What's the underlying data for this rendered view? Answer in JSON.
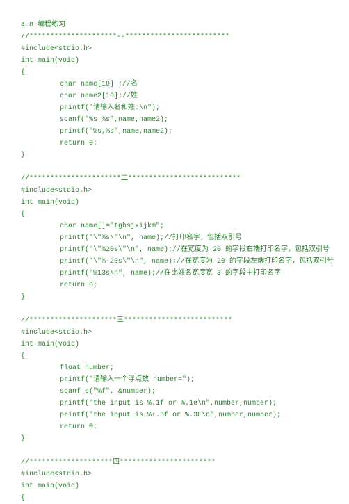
{
  "lines": [
    {
      "text": "4.8 编程练习",
      "indent": 0
    },
    {
      "text": "//*********************--*************************",
      "indent": 0
    },
    {
      "text": "#include<stdio.h>",
      "indent": 0
    },
    {
      "text": "int main(void)",
      "indent": 0
    },
    {
      "text": "{",
      "indent": 0
    },
    {
      "text": "char name[10] ;//名",
      "indent": 2
    },
    {
      "text": "char name2[10];//姓",
      "indent": 2
    },
    {
      "text": "printf(\"请输入名和姓:\\n\");",
      "indent": 2
    },
    {
      "text": "scanf(\"%s %s\",name,name2);",
      "indent": 2
    },
    {
      "text": "printf(\"%s,%s\",name,name2);",
      "indent": 2
    },
    {
      "text": "return 0;",
      "indent": 2
    },
    {
      "text": "}",
      "indent": 0
    },
    {
      "type": "blank"
    },
    {
      "text": "//**********************二***************************",
      "indent": 0
    },
    {
      "text": "#include<stdio.h>",
      "indent": 0
    },
    {
      "text": "int main(void)",
      "indent": 0
    },
    {
      "text": "{",
      "indent": 0
    },
    {
      "text": "char name[]=\"tghsjxijkm\";",
      "indent": 2
    },
    {
      "text": "printf(\"\\\"%s\\\"\\n\", name);//打印名字，包括双引号",
      "indent": 2
    },
    {
      "text": "printf(\"\\\"%20s\\\"\\n\", name);//在宽度为 20 的字段右端打印名字，包括双引号",
      "indent": 2
    },
    {
      "text": "printf(\"\\\"%-20s\\\"\\n\", name);//在宽度为 20 的字段左端打印名字，包括双引号",
      "indent": 2
    },
    {
      "text": "printf(\"%13s\\n\", name);//在比姓名宽度宽 3 的字段中打印名字",
      "indent": 2
    },
    {
      "text": "return 0;",
      "indent": 2
    },
    {
      "text": "}",
      "indent": 0
    },
    {
      "type": "blank"
    },
    {
      "text": "//*********************三**************************",
      "indent": 0
    },
    {
      "text": "#include<stdio.h>",
      "indent": 0
    },
    {
      "text": "int main(void)",
      "indent": 0
    },
    {
      "text": "{",
      "indent": 0
    },
    {
      "text": "float number;",
      "indent": 2
    },
    {
      "text": "printf(\"请输入一个浮点数 number=\");",
      "indent": 2
    },
    {
      "text": "scanf_s(\"%f\", &number);",
      "indent": 2
    },
    {
      "text": "printf(\"the input is %.1f or %.1e\\n\",number,number);",
      "indent": 2
    },
    {
      "text": "printf(\"the input is %+.3f or %.3E\\n\",number,number);",
      "indent": 2
    },
    {
      "text": "return 0;",
      "indent": 2
    },
    {
      "text": "}",
      "indent": 0
    },
    {
      "type": "blank"
    },
    {
      "text": "//********************四***********************",
      "indent": 0
    },
    {
      "text": "#include<stdio.h>",
      "indent": 0
    },
    {
      "text": "int main(void)",
      "indent": 0
    },
    {
      "text": "{",
      "indent": 0
    }
  ]
}
